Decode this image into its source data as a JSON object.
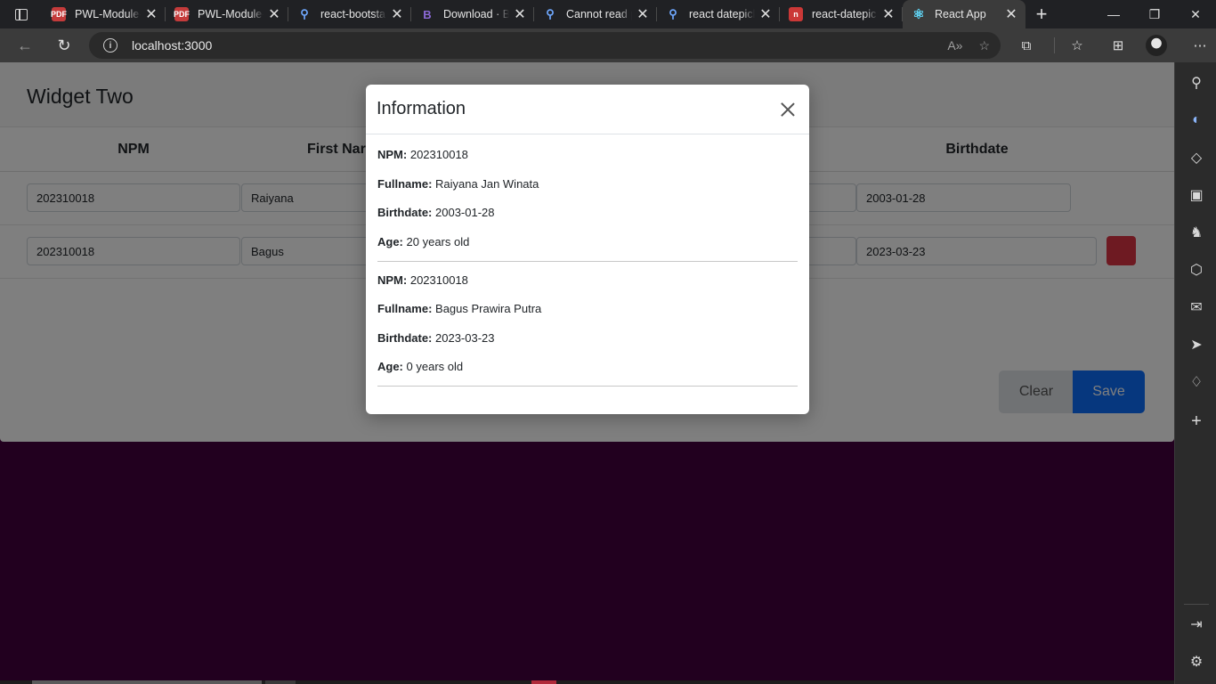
{
  "browser": {
    "tabs": [
      {
        "title": "PWL-Module-",
        "favicon": "pdf-icon"
      },
      {
        "title": "PWL-Module-",
        "favicon": "pdf-icon"
      },
      {
        "title": "react-bootsta",
        "favicon": "search-icon"
      },
      {
        "title": "Download · B",
        "favicon": "bootstrap-icon"
      },
      {
        "title": "Cannot read p",
        "favicon": "search-icon"
      },
      {
        "title": "react datepick",
        "favicon": "search-icon"
      },
      {
        "title": "react-datepic",
        "favicon": "npm-icon"
      },
      {
        "title": "React App",
        "favicon": "react-icon"
      }
    ],
    "url": "localhost:3000"
  },
  "widget": {
    "title": "Widget Two",
    "columns": [
      "NPM",
      "First Nar",
      "Birthdate"
    ],
    "rows": [
      {
        "npm": "202310018",
        "first": "Raiyana",
        "birthdate": "2003-01-28"
      },
      {
        "npm": "202310018",
        "first": "Bagus",
        "birthdate": "2023-03-23"
      }
    ],
    "clear_label": "Clear",
    "save_label": "Save"
  },
  "modal": {
    "title": "Information",
    "entries": [
      {
        "npm_label": "NPM:",
        "npm": "202310018",
        "fullname_label": "Fullname:",
        "fullname": "Raiyana Jan Winata",
        "birthdate_label": "Birthdate:",
        "birthdate": "2003-01-28",
        "age_label": "Age:",
        "age": "20 years old"
      },
      {
        "npm_label": "NPM:",
        "npm": "202310018",
        "fullname_label": "Fullname:",
        "fullname": "Bagus Prawira Putra",
        "birthdate_label": "Birthdate:",
        "birthdate": "2023-03-23",
        "age_label": "Age:",
        "age": "0 years old"
      }
    ]
  },
  "colors": {
    "page_background": "#44003f",
    "save_button": "#0d6efd",
    "delete_button": "#dc3545"
  }
}
